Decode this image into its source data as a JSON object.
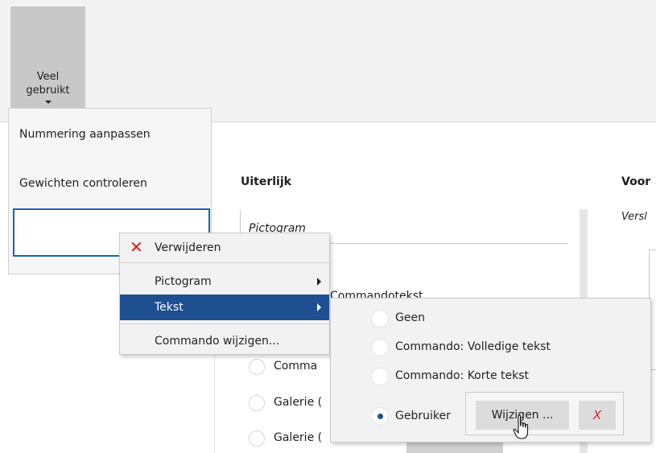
{
  "ribbon": {
    "veel_gebruikt_line1": "Veel",
    "veel_gebruikt_line2": "gebruikt"
  },
  "background": {
    "uiterlijk_heading": "Uiterlijk",
    "voor_heading": "Voor",
    "versl_text": "Versl",
    "pictogram_header": "Pictogram",
    "peek_label": "Commandotekst",
    "options": [
      "Comma",
      "Galerie (",
      "Galerie ("
    ]
  },
  "dropdown": {
    "items": [
      "Nummering aanpassen",
      "Gewichten controleren"
    ]
  },
  "context_menu": {
    "items": [
      {
        "label": "Verwijderen",
        "icon": "delete-x-icon"
      },
      {
        "label": "Pictogram",
        "has_submenu": true
      },
      {
        "label": "Tekst",
        "has_submenu": true,
        "active": true
      },
      {
        "label": "Commando wijzigen..."
      }
    ]
  },
  "submenu": {
    "options": [
      {
        "label": "Geen",
        "checked": false
      },
      {
        "label": "Commando: Volledige tekst",
        "checked": false
      },
      {
        "label": "Commando: Korte tekst",
        "checked": false
      },
      {
        "label": "Gebruiker",
        "checked": true
      }
    ],
    "wijzigen_label": "Wijzigen ...",
    "clear_label": "X"
  },
  "colors": {
    "accent": "#1d4f91",
    "delete_icon": "#e51a1a",
    "selection_border": "#1d64a8"
  }
}
